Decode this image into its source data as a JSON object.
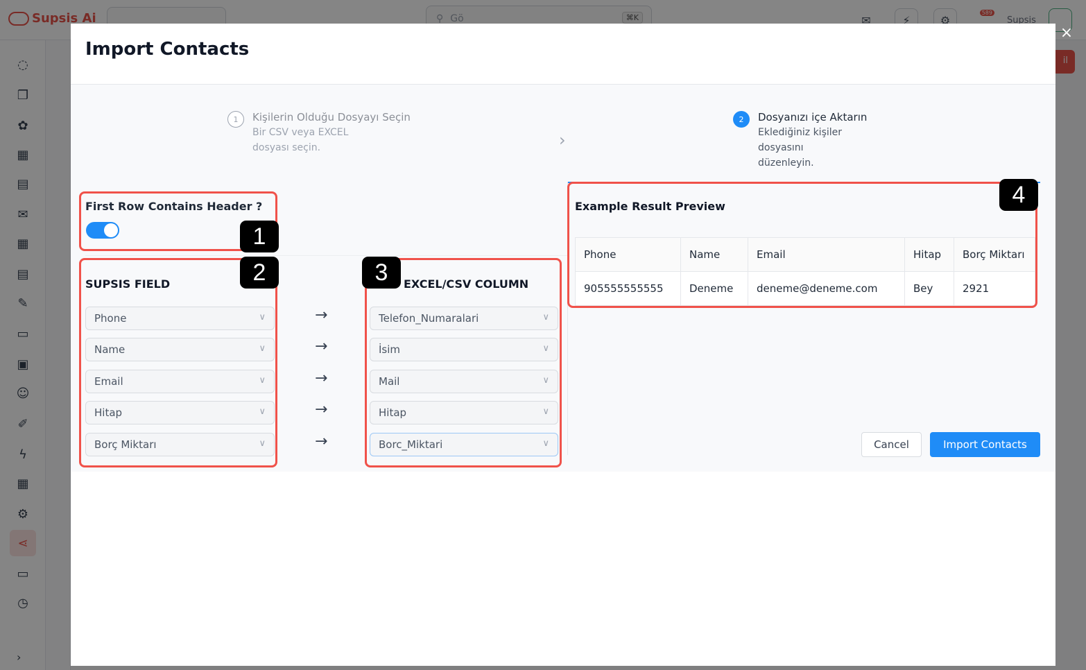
{
  "app": {
    "brand": "Supsis Ai",
    "search_placeholder": "Gö",
    "search_shortcut": "⌘K",
    "user_label": "Supsis",
    "notification_badge": "589",
    "red_button_label": "il"
  },
  "modal": {
    "title": "Import Contacts",
    "close_label": "×",
    "steps": [
      {
        "number": "1",
        "title": "Kişilerin Olduğu Dosyayı Seçin",
        "description": "Bir CSV veya EXCEL dosyası seçin."
      },
      {
        "number": "2",
        "title": "Dosyanızı içe Aktarın",
        "description": "Eklediğiniz kişiler dosyasını düzenleyin."
      }
    ],
    "header_toggle": {
      "label": "First Row Contains Header ?",
      "on": true
    },
    "mapping": {
      "left_title": "SUPSIS FIELD",
      "right_title": "EXCEL/CSV COLUMN",
      "arrow": "→",
      "rows": [
        {
          "field": "Phone",
          "column": "Telefon_Numaralari"
        },
        {
          "field": "Name",
          "column": "İsim"
        },
        {
          "field": "Email",
          "column": "Mail"
        },
        {
          "field": "Hitap",
          "column": "Hitap"
        },
        {
          "field": "Borç Miktarı",
          "column": "Borc_Miktari"
        }
      ]
    },
    "preview": {
      "title": "Example Result Preview",
      "columns": [
        "Phone",
        "Name",
        "Email",
        "Hitap",
        "Borç Miktarı"
      ],
      "row": [
        "905555555555",
        "Deneme",
        "deneme@deneme.com",
        "Bey",
        "2921"
      ]
    },
    "buttons": {
      "cancel": "Cancel",
      "import": "Import Contacts"
    }
  },
  "annotations": [
    "1",
    "2",
    "3",
    "4"
  ]
}
